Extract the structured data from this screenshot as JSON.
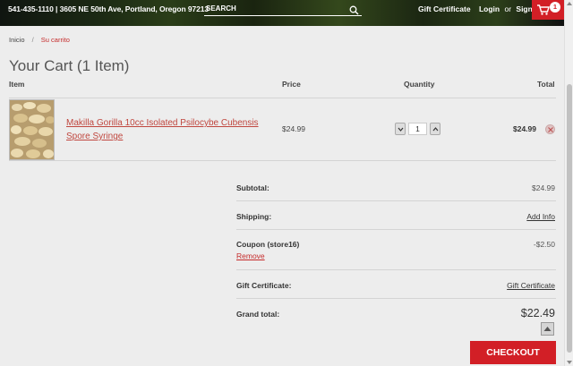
{
  "header": {
    "contact": "541-435-1110 | 3605 NE 50th Ave, Portland, Oregon 97213",
    "search_placeholder": "SEARCH",
    "gift_certificate": "Gift Certificate",
    "login": "Login",
    "or": "or",
    "signup": "Sign Up",
    "cart_count": "1"
  },
  "breadcrumb": {
    "home": "Inicio",
    "separator": "/",
    "current": "Su carrito"
  },
  "page_title": "Your Cart (1 Item)",
  "table": {
    "headers": {
      "item": "Item",
      "price": "Price",
      "quantity": "Quantity",
      "total": "Total"
    },
    "items": [
      {
        "name": "Makilla Gorilla 10cc Isolated Psilocybe Cubensis Spore Syringe",
        "price": "$24.99",
        "quantity": "1",
        "total": "$24.99"
      }
    ]
  },
  "totals": {
    "subtotal_label": "Subtotal:",
    "subtotal_value": "$24.99",
    "shipping_label": "Shipping:",
    "shipping_value": "Add Info",
    "coupon_label": "Coupon (store16)",
    "coupon_value": "-$2.50",
    "coupon_remove": "Remove",
    "gift_label": "Gift Certificate:",
    "gift_value": "Gift Certificate",
    "grand_label": "Grand total:",
    "grand_value": "$22.49"
  },
  "checkout_label": "CHECKOUT",
  "colors": {
    "accent": "#d21f26",
    "link": "#c0473f",
    "background": "#ededed"
  },
  "icons": [
    "search-icon",
    "cart-icon",
    "minus-icon",
    "plus-icon",
    "close-icon",
    "chevron-up-icon"
  ]
}
